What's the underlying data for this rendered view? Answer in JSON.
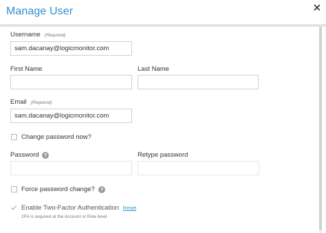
{
  "modal": {
    "title": "Manage User"
  },
  "form": {
    "username": {
      "label": "Username",
      "required_tag": "(Required)",
      "value": "sam.dacanay@logicmonitor.com"
    },
    "first_name": {
      "label": "First Name",
      "value": ""
    },
    "last_name": {
      "label": "Last Name",
      "value": ""
    },
    "email": {
      "label": "Email",
      "required_tag": "(Required)",
      "value": "sam.dacanay@logicmonitor.com"
    },
    "change_password": {
      "label": "Change password now?",
      "checked": false
    },
    "password": {
      "label": "Password",
      "value": "",
      "help_icon": "question-circle-icon"
    },
    "retype_password": {
      "label": "Retype password",
      "value": ""
    },
    "force_password_change": {
      "label": "Force password change?",
      "checked": false,
      "help_icon": "question-circle-icon"
    },
    "two_factor": {
      "label": "Enable Two-Factor Authentication",
      "checked": true,
      "reset_link": "Reset",
      "note": "2FA is required at the Account or Role level"
    }
  },
  "icons": {
    "close": "close-icon",
    "help_glyph": "?"
  },
  "colors": {
    "accent": "#2f8fd0",
    "text": "#333333",
    "border": "#cfcfcf",
    "muted": "#777777"
  }
}
